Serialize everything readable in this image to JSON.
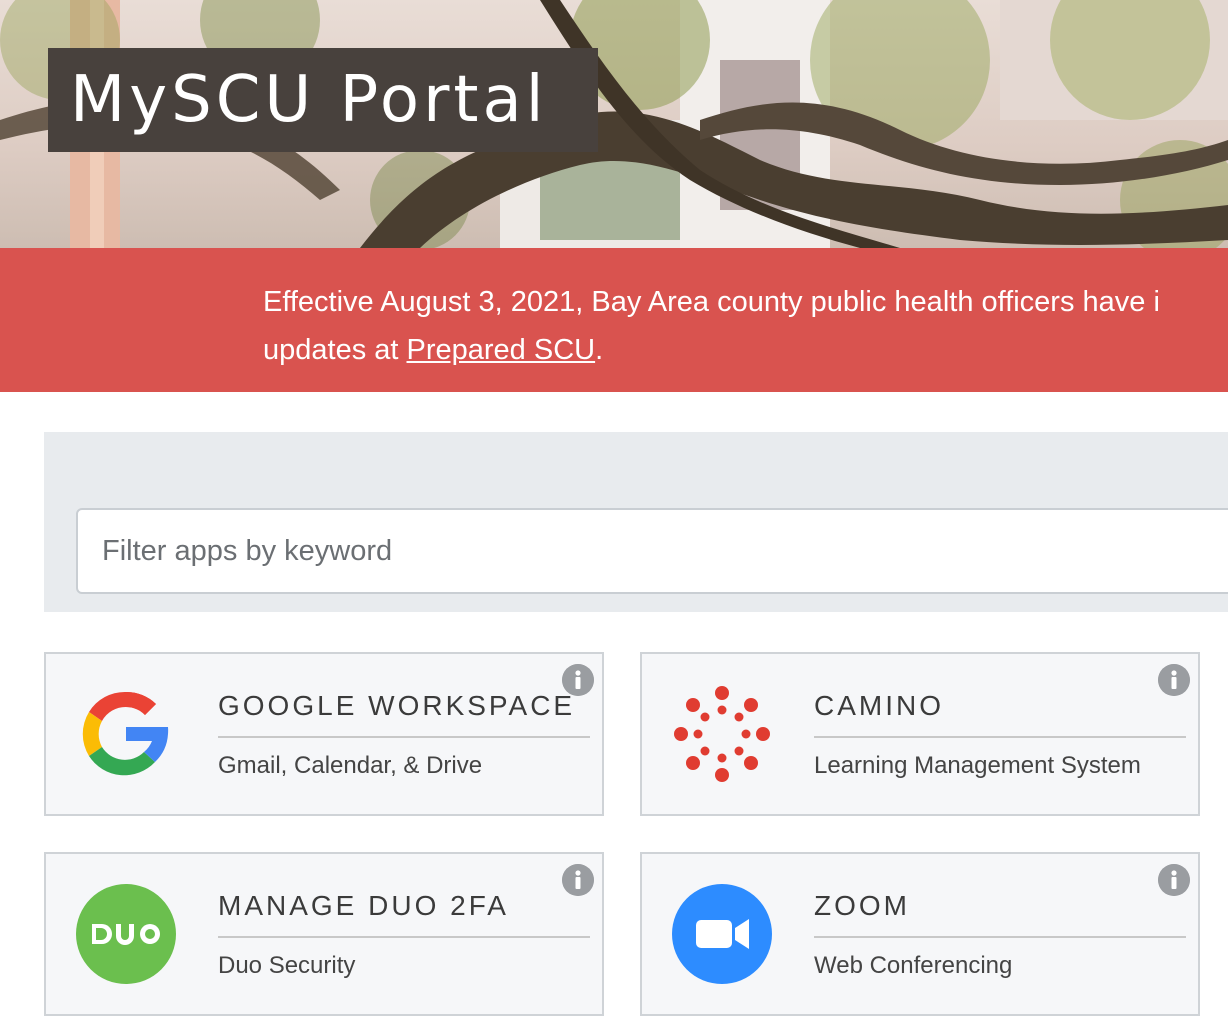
{
  "header": {
    "title": "MySCU Portal"
  },
  "alert": {
    "line1": "Effective August 3, 2021, Bay Area county public health officers have i",
    "line2_prefix": "updates at ",
    "link_text": "Prepared SCU",
    "line2_suffix": "."
  },
  "filter": {
    "placeholder": "Filter apps by keyword",
    "value": ""
  },
  "apps": [
    {
      "title": "GOOGLE WORKSPACE",
      "subtitle": "Gmail, Calendar, & Drive",
      "icon": "google-g-icon"
    },
    {
      "title": "CAMINO",
      "subtitle": "Learning Management System",
      "icon": "camino-icon"
    },
    {
      "title": "MANAGE DUO 2FA",
      "subtitle": "Duo Security",
      "icon": "duo-icon"
    },
    {
      "title": "ZOOM",
      "subtitle": "Web Conferencing",
      "icon": "zoom-icon"
    }
  ],
  "colors": {
    "alert_bg": "#d9534f",
    "title_bg": "#48413d",
    "filter_bg": "#e8ebee",
    "card_bg": "#f6f7f9",
    "camino_red": "#e03c31",
    "duo_green": "#6bbf4e",
    "zoom_blue": "#2d8cff"
  }
}
